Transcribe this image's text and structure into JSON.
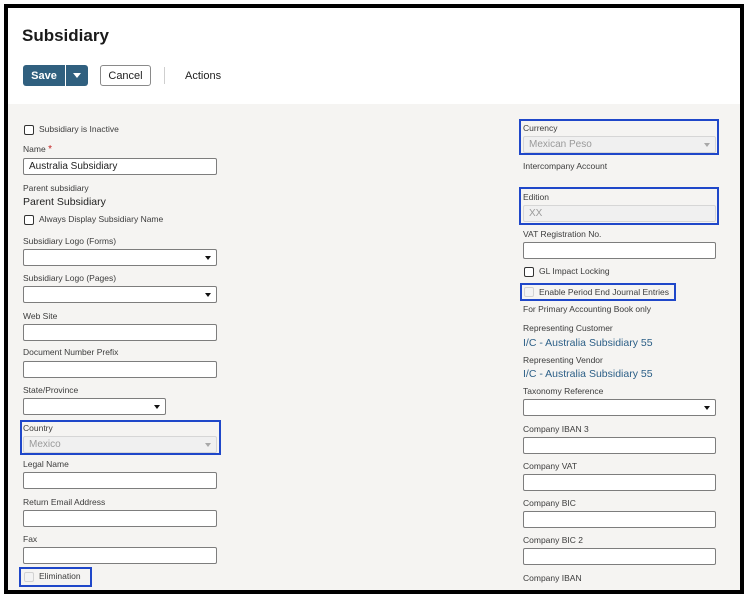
{
  "page": {
    "title": "Subsidiary"
  },
  "toolbar": {
    "save_label": "Save",
    "cancel_label": "Cancel",
    "actions_label": "Actions"
  },
  "left": {
    "inactive_label": "Subsidiary is Inactive",
    "name_label": "Name",
    "name_required": "*",
    "name_value": "Australia Subsidiary",
    "parent_label": "Parent subsidiary",
    "parent_value": "Parent Subsidiary",
    "always_display_label": "Always Display Subsidiary Name",
    "logo_forms_label": "Subsidiary Logo (Forms)",
    "logo_forms_value": "",
    "logo_pages_label": "Subsidiary Logo (Pages)",
    "logo_pages_value": "",
    "web_site_label": "Web Site",
    "web_site_value": "",
    "doc_prefix_label": "Document Number Prefix",
    "doc_prefix_value": "",
    "state_label": "State/Province",
    "state_value": "",
    "country_label": "Country",
    "country_value": "Mexico",
    "legal_name_label": "Legal Name",
    "legal_name_value": "",
    "return_email_label": "Return Email Address",
    "return_email_value": "",
    "fax_label": "Fax",
    "fax_value": "",
    "elimination_label": "Elimination"
  },
  "right": {
    "currency_label": "Currency",
    "currency_value": "Mexican Peso",
    "intercompany_label": "Intercompany Account",
    "edition_label": "Edition",
    "edition_value": "XX",
    "vat_reg_label": "VAT Registration No.",
    "vat_reg_value": "",
    "gl_locking_label": "GL Impact Locking",
    "period_end_label": "Enable Period End Journal Entries",
    "primary_book_label": "For Primary Accounting Book only",
    "rep_customer_label": "Representing Customer",
    "rep_customer_value": "I/C - Australia Subsidiary 55",
    "rep_vendor_label": "Representing Vendor",
    "rep_vendor_value": "I/C - Australia Subsidiary 55",
    "taxonomy_label": "Taxonomy Reference",
    "taxonomy_value": "",
    "iban3_label": "Company IBAN 3",
    "iban3_value": "",
    "company_vat_label": "Company VAT",
    "company_vat_value": "",
    "bic_label": "Company BIC",
    "bic_value": "",
    "bic2_label": "Company BIC 2",
    "bic2_value": "",
    "iban_label": "Company IBAN"
  },
  "colors": {
    "primary_button": "#30607f",
    "highlight": "#1f47c9",
    "link": "#2c5f87",
    "required": "#c21f1f"
  },
  "icons": {
    "dropdown": "chevron-down-icon"
  }
}
